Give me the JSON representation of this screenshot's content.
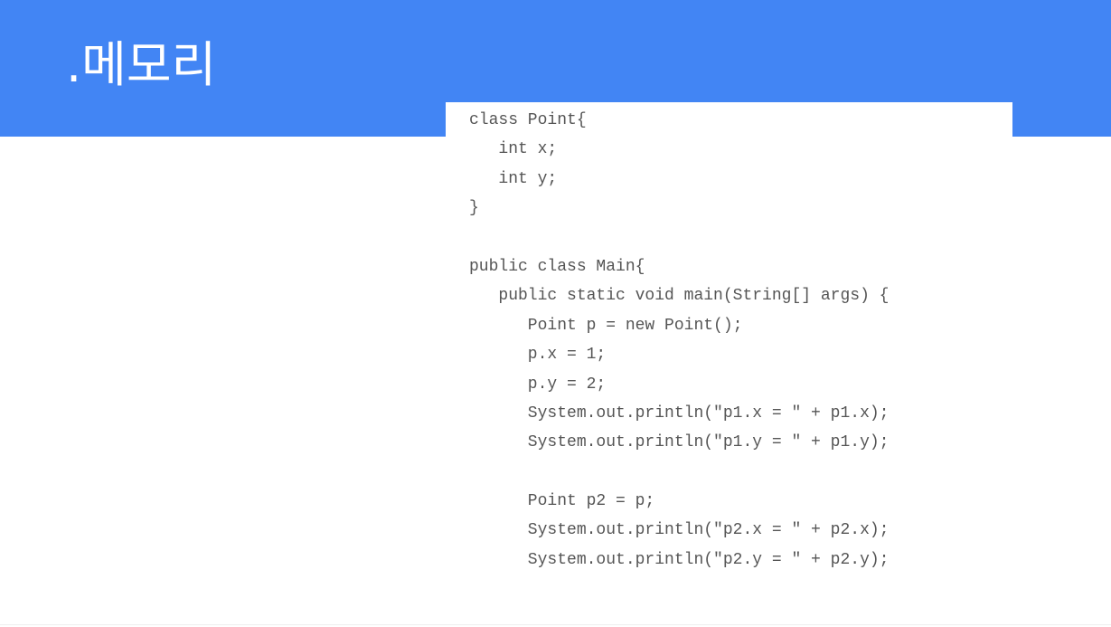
{
  "slide": {
    "title": ".메모리"
  },
  "code": {
    "language": "java",
    "lines": [
      "class Point{",
      "   int x;",
      "   int y;",
      "}",
      "",
      "public class Main{",
      "   public static void main(String[] args) {",
      "      Point p = new Point();",
      "      p.x = 1;",
      "      p.y = 2;",
      "      System.out.println(\"p1.x = \" + p1.x);",
      "      System.out.println(\"p1.y = \" + p1.y);",
      "",
      "      Point p2 = p;",
      "      System.out.println(\"p2.x = \" + p2.x);",
      "      System.out.println(\"p2.y = \" + p2.y);"
    ]
  },
  "colors": {
    "header": "#4285f4",
    "title_text": "#ffffff",
    "code_text": "#555555",
    "background": "#ffffff"
  }
}
